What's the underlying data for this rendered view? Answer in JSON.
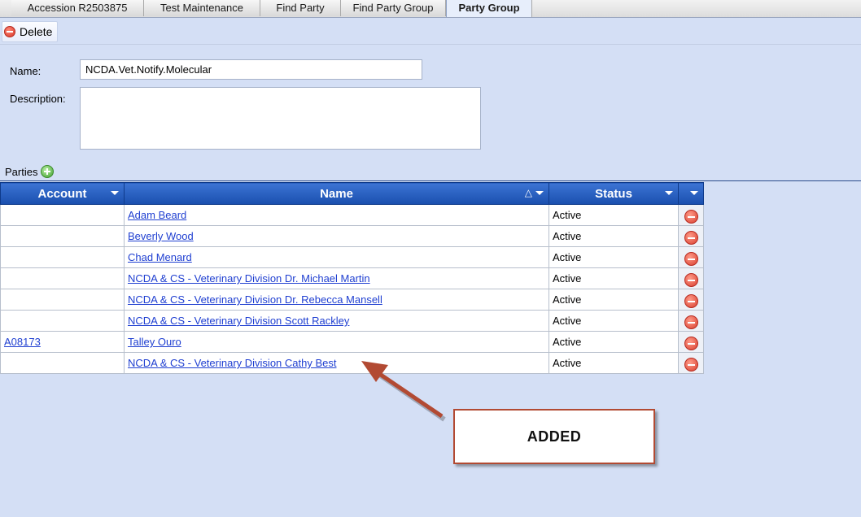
{
  "tabs": [
    {
      "label": "Accession R2503875",
      "active": false
    },
    {
      "label": "Test Maintenance",
      "active": false
    },
    {
      "label": "Find Party",
      "active": false
    },
    {
      "label": "Find Party Group",
      "active": false
    },
    {
      "label": "Party Group",
      "active": true
    }
  ],
  "toolbar": {
    "delete_label": "Delete"
  },
  "form": {
    "name_label": "Name:",
    "name_value": "NCDA.Vet.Notify.Molecular",
    "description_label": "Description:",
    "description_value": ""
  },
  "parties": {
    "label": "Parties",
    "columns": {
      "account": "Account",
      "name": "Name",
      "status": "Status",
      "sort_indicator": "△"
    },
    "rows": [
      {
        "account": "",
        "name": "Adam Beard",
        "status": "Active"
      },
      {
        "account": "",
        "name": "Beverly Wood",
        "status": "Active"
      },
      {
        "account": "",
        "name": "Chad Menard",
        "status": "Active"
      },
      {
        "account": "",
        "name": "NCDA & CS - Veterinary Division Dr. Michael Martin",
        "status": "Active"
      },
      {
        "account": "",
        "name": "NCDA & CS - Veterinary Division Dr. Rebecca Mansell",
        "status": "Active"
      },
      {
        "account": "",
        "name": "NCDA & CS - Veterinary Division Scott Rackley",
        "status": "Active"
      },
      {
        "account": "A08173",
        "name": "Talley Ouro",
        "status": "Active"
      },
      {
        "account": "",
        "name": "NCDA & CS - Veterinary Division Cathy Best",
        "status": "Active"
      }
    ]
  },
  "annotation": {
    "text": "ADDED",
    "color": "#b24a33"
  }
}
